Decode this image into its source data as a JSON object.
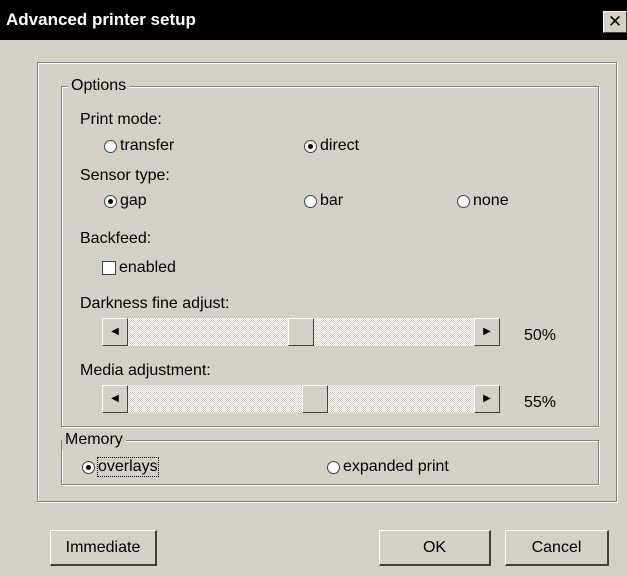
{
  "window": {
    "title": "Advanced printer setup",
    "close_glyph": "✕"
  },
  "options": {
    "legend": "Options",
    "print_mode": {
      "label": "Print mode:",
      "transfer": "transfer",
      "direct": "direct",
      "selected": "direct"
    },
    "sensor_type": {
      "label": "Sensor type:",
      "gap": "gap",
      "bar": "bar",
      "none": "none",
      "selected": "gap"
    },
    "backfeed": {
      "label": "Backfeed:",
      "enabled_label": "enabled",
      "checked": false
    },
    "darkness": {
      "label": "Darkness fine adjust:",
      "value_text": "50%",
      "value": 0.5
    },
    "media": {
      "label": "Media adjustment:",
      "value_text": "55%",
      "value": 0.55
    }
  },
  "memory": {
    "legend": "Memory",
    "overlays": "overlays",
    "expanded_print": "expanded print",
    "selected": "overlays"
  },
  "buttons": {
    "immediate": "Immediate",
    "ok": "OK",
    "cancel": "Cancel"
  },
  "icons": {
    "left_arrow": "left-arrow-icon",
    "right_arrow": "right-arrow-icon"
  }
}
